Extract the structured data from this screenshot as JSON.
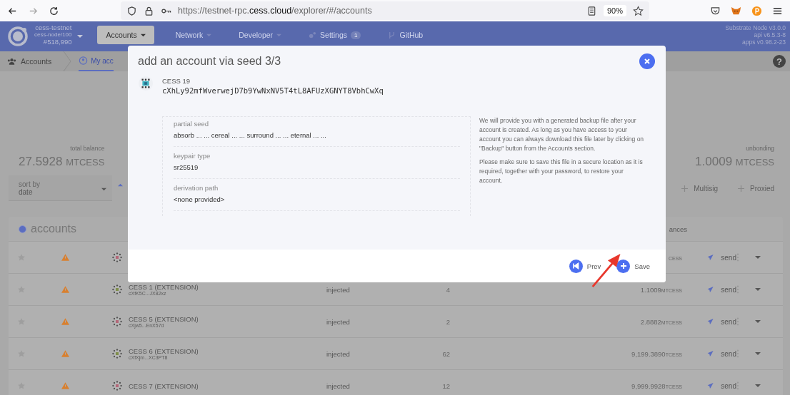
{
  "browser": {
    "url_scheme": "https://testnet-rpc.",
    "url_host": "cess.cloud",
    "url_path": "/explorer/#/accounts",
    "zoom": "90%"
  },
  "nav": {
    "chain": {
      "name": "cess-testnet",
      "node": "cess-node/100",
      "block": "#518,990"
    },
    "tabs": [
      {
        "label": "Accounts",
        "selected": true,
        "kind": "menu"
      },
      {
        "label": "Network",
        "selected": false,
        "kind": "menu"
      },
      {
        "label": "Developer",
        "selected": false,
        "kind": "menu"
      },
      {
        "label": "Settings",
        "selected": false,
        "kind": "badge",
        "badge": "1"
      },
      {
        "label": "GitHub",
        "selected": false,
        "kind": "link"
      }
    ],
    "versions": [
      "Substrate Node v3.0.0",
      "api v6.5.3-8",
      "apps v0.98.2-23"
    ]
  },
  "help": "?",
  "breadcrumb": [
    {
      "label": "Accounts",
      "selected": false
    },
    {
      "label": "My acc",
      "selected": true
    }
  ],
  "summary": [
    {
      "label": "total balance",
      "value": "27.5928",
      "unit": "MTCESS"
    },
    {
      "label": "unbonding",
      "value": "1.0009",
      "unit": "MTCESS"
    }
  ],
  "sort": {
    "label": "sort by",
    "value": "date"
  },
  "actions": [
    "Multisig",
    "Proxied"
  ],
  "accounts": {
    "title": "accounts",
    "balances_header": "ances",
    "rows": [
      {
        "unit": "CESS",
        "action": "send"
      },
      {
        "name": "CESS 1 (EXTENSION)",
        "address": "cXfK5C...JX82xz",
        "type": "injected",
        "count": "4",
        "amount": "1.1009",
        "unit": "MTCESS",
        "action": "send"
      },
      {
        "name": "CESS 5 (EXTENSION)",
        "address": "cXjw5...EnX57d",
        "type": "injected",
        "count": "2",
        "amount": "2.8882",
        "unit": "MTCESS",
        "action": "send"
      },
      {
        "name": "CESS 6 (EXTENSION)",
        "address": "cXfXjm...XC3PT8",
        "type": "injected",
        "count": "62",
        "amount": "9,199.3890",
        "unit": "TCESS",
        "action": "send"
      },
      {
        "name": "CESS 7 (EXTENSION)",
        "type": "injected",
        "count": "12",
        "amount": "9,999.9928",
        "unit": "TCESS",
        "action": "send"
      }
    ]
  },
  "modal": {
    "title": "add an account via seed 3/3",
    "account_name": "CESS 19",
    "address": "cXhLy92mfWverwejD7b9YwNxNV5T4tL8AFUzXGNYT8VbhCwXq",
    "fields": [
      {
        "label": "partial seed",
        "value": "absorb ... ... cereal ... ... surround ... ... eternal ... ..."
      },
      {
        "label": "keypair type",
        "value": "sr25519"
      },
      {
        "label": "derivation path",
        "value": "<none provided>"
      }
    ],
    "help": [
      "We will provide you with a generated backup file after your account is created. As long as you have access to your account you can always download this file later by clicking on \"Backup\" button from the Accounts section.",
      "Please make sure to save this file in a secure location as it is required, together with your password, to restore your account."
    ],
    "buttons": [
      {
        "label": "Prev",
        "kind": "prev"
      },
      {
        "label": "Save",
        "kind": "save"
      }
    ]
  }
}
